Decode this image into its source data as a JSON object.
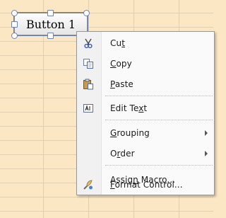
{
  "form_control": {
    "label": "Button 1"
  },
  "context_menu": {
    "items": [
      {
        "label": "Cut",
        "accel": "t",
        "icon": "scissors-icon"
      },
      {
        "label": "Copy",
        "accel": "C",
        "icon": "copy-icon"
      },
      {
        "label": "Paste",
        "accel": "P",
        "icon": "paste-icon"
      },
      {
        "label": "Edit Text",
        "accel": "x",
        "icon": "edit-text-icon"
      },
      {
        "label": "Grouping",
        "accel": "G",
        "submenu": true
      },
      {
        "label": "Order",
        "accel": "r",
        "submenu": true
      },
      {
        "label": "Assign Macro...",
        "accel": "n"
      },
      {
        "label": "Format Control...",
        "accel": "F",
        "icon": "format-control-icon"
      }
    ]
  },
  "colors": {
    "sheet_background": "#fce7c4",
    "menu_background": "#fafafa",
    "selection_handle_border": "#6d84ad"
  }
}
